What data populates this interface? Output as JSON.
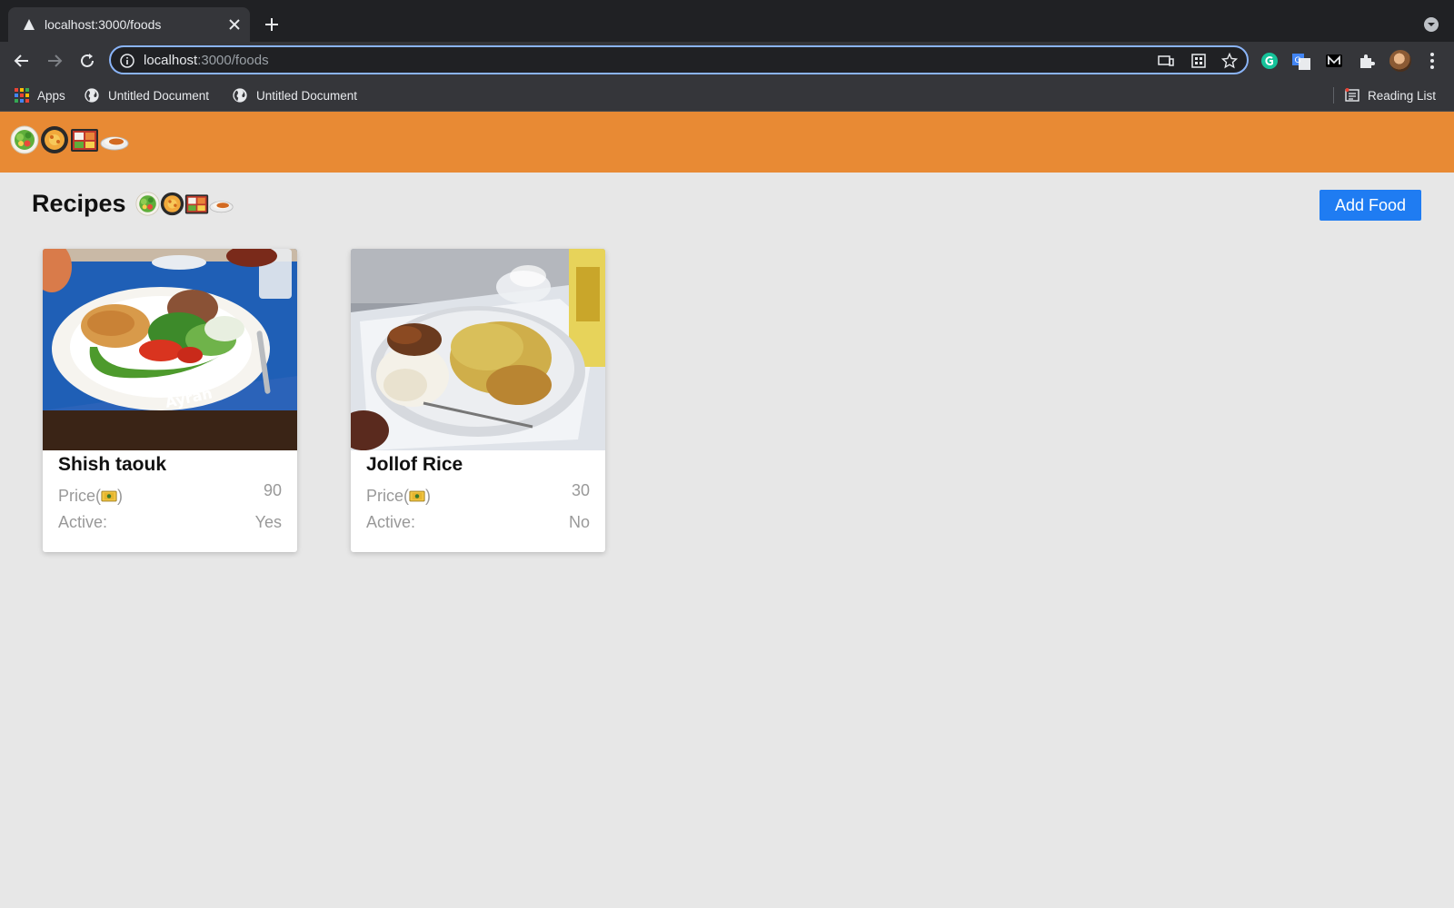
{
  "browser": {
    "tab_title": "localhost:3000/foods",
    "url_host": "localhost",
    "url_path": ":3000/foods",
    "bookmarks": [
      {
        "label": "Apps",
        "icon": "apps-grid-icon"
      },
      {
        "label": "Untitled Document",
        "icon": "globe-icon"
      },
      {
        "label": "Untitled Document",
        "icon": "globe-icon"
      }
    ],
    "reading_list": "Reading List"
  },
  "navbar": {
    "brand_icons": [
      "salad-icon",
      "pan-icon",
      "bento-icon",
      "curry-icon"
    ]
  },
  "main": {
    "title": "Recipes",
    "add_button": "Add Food"
  },
  "foods": [
    {
      "name": "Shish taouk",
      "price_label": "Price(",
      "price_suffix": ")",
      "price": "90",
      "active_label": "Active:",
      "active": "Yes",
      "image": "food-photo-shish-taouk"
    },
    {
      "name": "Jollof Rice",
      "price_label": "Price(",
      "price_suffix": ")",
      "price": "30",
      "active_label": "Active:",
      "active": "No",
      "image": "food-photo-jollof-rice"
    }
  ],
  "colors": {
    "navbar": "#e88a34",
    "page_bg": "#e7e7e7",
    "button": "#1f7cf2",
    "chrome_dark": "#202124",
    "chrome": "#35363a"
  }
}
